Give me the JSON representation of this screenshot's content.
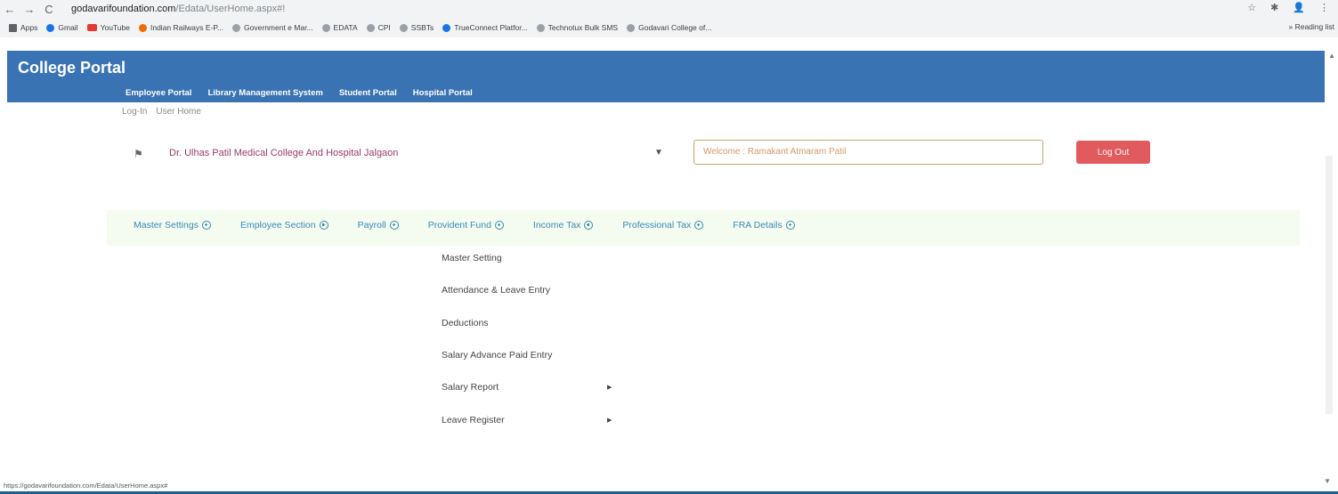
{
  "browser": {
    "back": "←",
    "forward": "→",
    "reload": "C",
    "lock": "🔒",
    "url_domain": "godavarifoundation.com",
    "url_path": "/Edata/UserHome.aspx#!",
    "right_icons": [
      "☆",
      "✱",
      "👤",
      "⋮"
    ],
    "bookmarks": [
      {
        "label": "Apps",
        "icon": "apps-grid-icon"
      },
      {
        "label": "Gmail",
        "icon": "gmail-icon"
      },
      {
        "label": "YouTube",
        "icon": "youtube-icon"
      },
      {
        "label": "Indian Railways E-P...",
        "icon": "railways-icon"
      },
      {
        "label": "Government e Mar...",
        "icon": "gem-icon"
      },
      {
        "label": "EDATA",
        "icon": "globe-icon"
      },
      {
        "label": "CPI",
        "icon": "globe-icon"
      },
      {
        "label": "SSBTs",
        "icon": "globe-icon"
      },
      {
        "label": "TrueConnect Platfor...",
        "icon": "trueconnect-icon"
      },
      {
        "label": "Technotux Bulk SMS",
        "icon": "globe-icon"
      },
      {
        "label": "Godavari College of...",
        "icon": "globe-icon"
      }
    ],
    "more_bookmarks": "»",
    "reading_list": "Reading list"
  },
  "header": {
    "brand": "College Portal",
    "nav": [
      "Employee Portal",
      "Library Management System",
      "Student Portal",
      "Hospital Portal"
    ]
  },
  "breadcrumb": [
    "Log-In",
    "User Home"
  ],
  "college_select": {
    "value": "Dr. Ulhas Patil Medical College And Hospital Jalgaon"
  },
  "welcome_field": {
    "value": "Welcome : Ramakant Atmaram Patil"
  },
  "logout_label": "Log Out",
  "menu": [
    "Master Settings",
    "Employee Section",
    "Payroll",
    "Provident Fund",
    "Income Tax",
    "Professional Tax",
    "FRA Details"
  ],
  "payroll_dropdown": [
    {
      "label": "Master Setting",
      "submenu": false
    },
    {
      "label": "Attendance & Leave Entry",
      "submenu": false
    },
    {
      "label": "Deductions",
      "submenu": false
    },
    {
      "label": "Salary Advance Paid Entry",
      "submenu": false
    },
    {
      "label": "Salary Report",
      "submenu": true
    },
    {
      "label": "Leave Register",
      "submenu": true
    }
  ],
  "status_url": "https://godavarifoundation.com/Edata/UserHome.aspx#",
  "colors": {
    "header": "#3a73b4",
    "logout": "#e05a5e",
    "menu_link": "#3a8ab8",
    "college_text": "#9b3b6a"
  }
}
